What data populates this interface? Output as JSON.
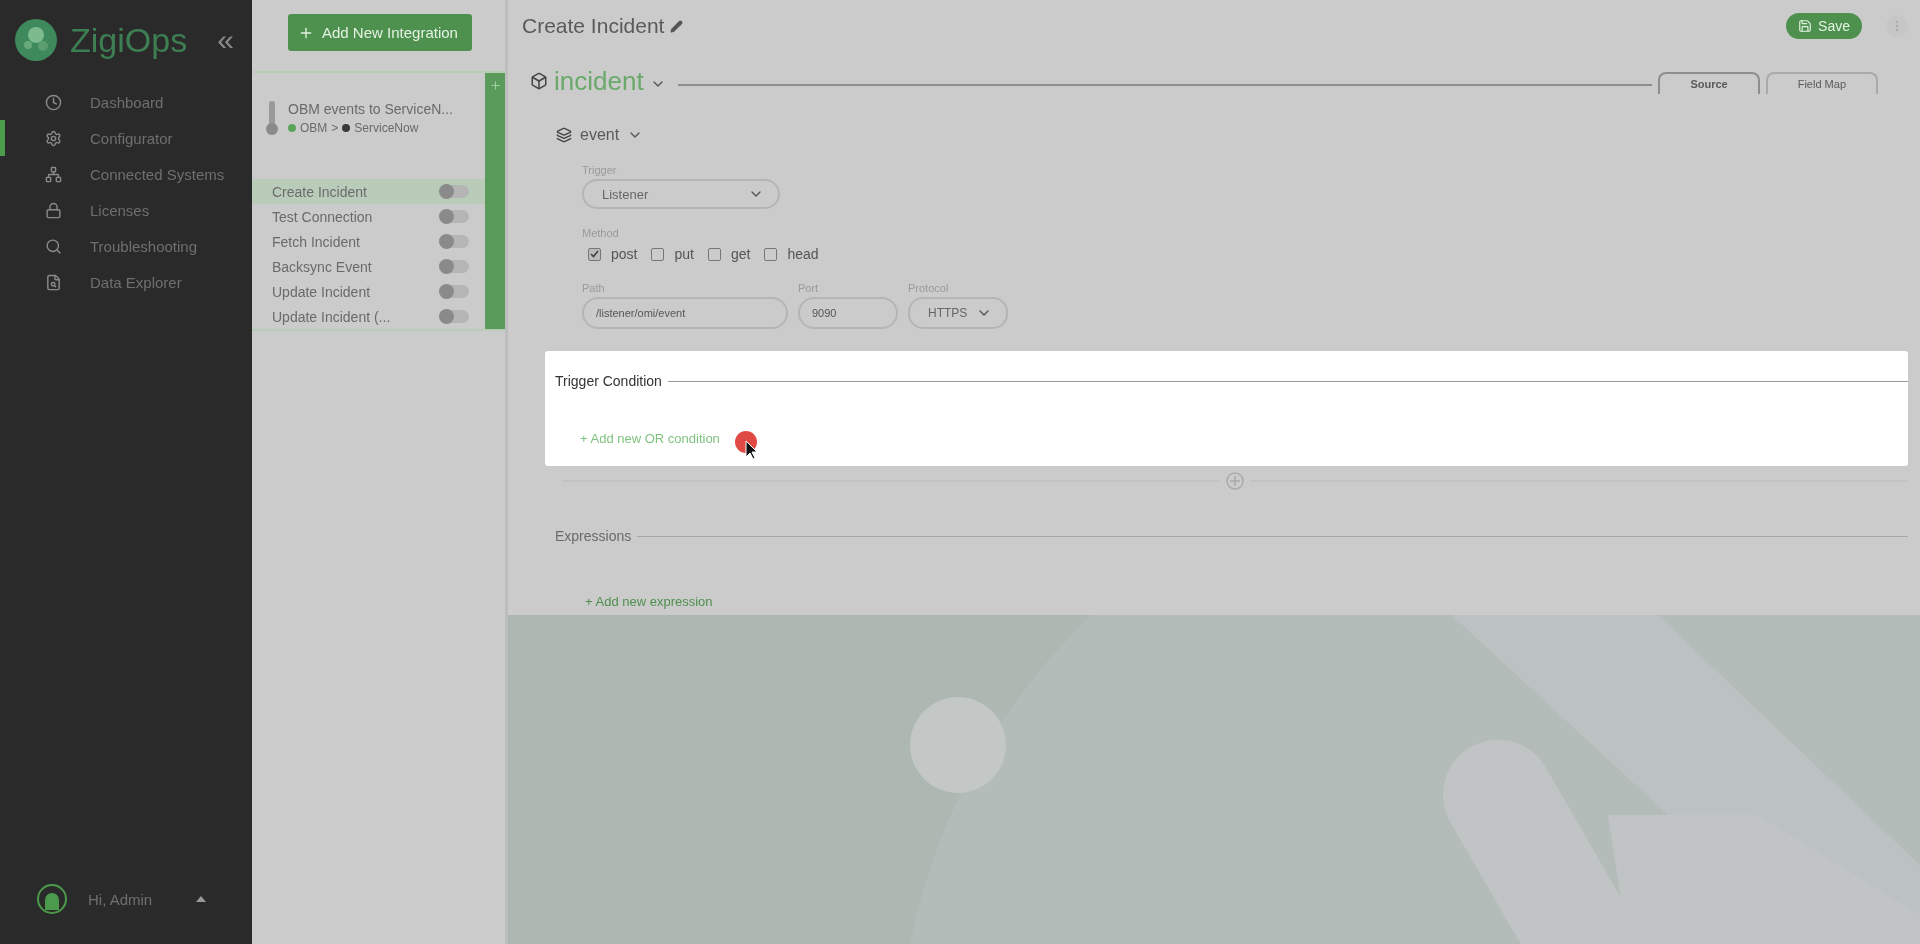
{
  "sidebar": {
    "logo": "ZigiOps",
    "collapse_icon": "«",
    "items": [
      {
        "label": "Dashboard",
        "selected": false
      },
      {
        "label": "Configurator",
        "selected": true
      },
      {
        "label": "Connected Systems",
        "selected": false
      },
      {
        "label": "Licenses",
        "selected": false
      },
      {
        "label": "Troubleshooting",
        "selected": false
      },
      {
        "label": "Data Explorer",
        "selected": false
      }
    ],
    "user": "Hi, Admin"
  },
  "integrations": {
    "add_button": "Add New Integration",
    "integration": {
      "name": "OBM events to ServiceN...",
      "source": {
        "name": "OBM",
        "color": "#5aa55a"
      },
      "separator": ">",
      "target": {
        "name": "ServiceNow",
        "color": "#3a3a3a"
      }
    },
    "flows": [
      {
        "label": "Create Incident",
        "selected": true,
        "on": false
      },
      {
        "label": "Test Connection",
        "selected": false,
        "on": false
      },
      {
        "label": "Fetch Incident",
        "selected": false,
        "on": false
      },
      {
        "label": "Backsync Event",
        "selected": false,
        "on": false
      },
      {
        "label": "Update Incident",
        "selected": false,
        "on": false
      },
      {
        "label": "Update Incident (...",
        "selected": false,
        "on": false
      }
    ]
  },
  "main": {
    "title": "Create Incident",
    "save_button": "Save",
    "entity": "incident",
    "tabs": [
      {
        "label": "Source",
        "selected": true
      },
      {
        "label": "Field Map",
        "selected": false
      }
    ],
    "source": {
      "name": "event",
      "trigger": {
        "label": "Trigger",
        "value": "Listener"
      },
      "method": {
        "label": "Method",
        "options": [
          {
            "label": "post",
            "checked": true
          },
          {
            "label": "put",
            "checked": false
          },
          {
            "label": "get",
            "checked": false
          },
          {
            "label": "head",
            "checked": false
          }
        ]
      },
      "path": {
        "label": "Path",
        "value": "/listener/omi/event"
      },
      "port": {
        "label": "Port",
        "value": "9090"
      },
      "protocol": {
        "label": "Protocol",
        "value": "HTTPS"
      }
    },
    "trigger_condition": {
      "title": "Trigger Condition",
      "add_link": "+ Add new OR condition"
    },
    "expressions": {
      "title": "Expressions",
      "add_link": "+ Add new expression"
    }
  }
}
